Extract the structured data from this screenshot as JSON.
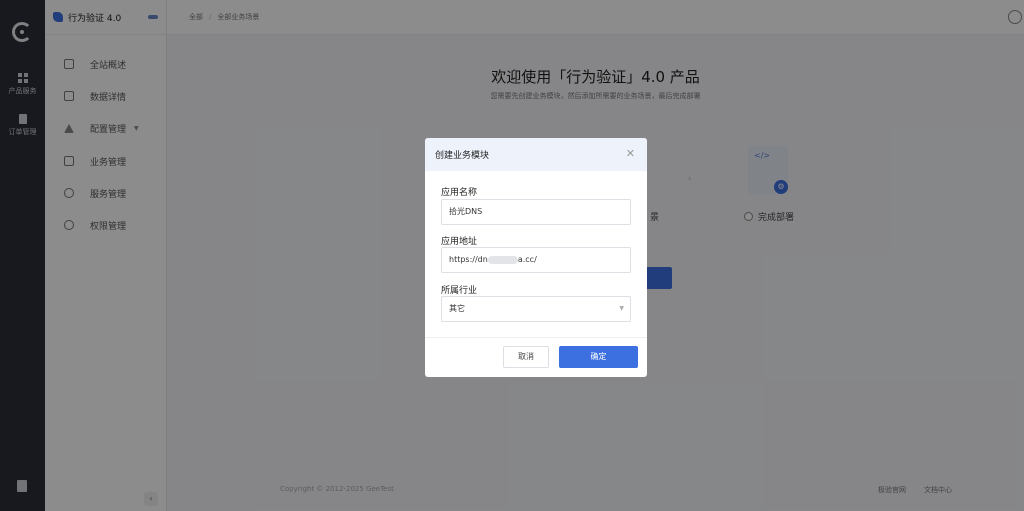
{
  "rail": {
    "items": [
      {
        "label": "产品服务",
        "icon": "grid-icon"
      },
      {
        "label": "订单管理",
        "icon": "document-icon"
      }
    ]
  },
  "sidebar": {
    "brand": "行为验证 4.0",
    "badge": "",
    "items": [
      {
        "label": "全站概述",
        "icon": "page-icon"
      },
      {
        "label": "数据详情",
        "icon": "chart-icon"
      },
      {
        "label": "配置管理",
        "icon": "warning-icon"
      },
      {
        "label": "业务管理",
        "icon": "box-icon"
      },
      {
        "label": "服务管理",
        "icon": "gear-icon"
      },
      {
        "label": "权限管理",
        "icon": "lock-icon"
      }
    ]
  },
  "topbar": {
    "breadcrumb": [
      "全部",
      "全部业务场景"
    ]
  },
  "main": {
    "title": "欢迎使用「行为验证」4.0 产品",
    "subtitle": "您需要先创建业务模块，然后添加所需要的业务场景，最后完成部署",
    "step_fragment": "景",
    "step_done": "完成部署"
  },
  "footer": {
    "copyright": "Copyright © 2012-2025 GeeTest",
    "link1": "极验官网",
    "link2": "文档中心"
  },
  "modal": {
    "title": "创建业务模块",
    "name_label": "应用名称",
    "name_value": "拾光DNS",
    "url_label": "应用地址",
    "url_prefix": "https://dn",
    "url_suffix": "a.cc/",
    "industry_label": "所属行业",
    "industry_value": "其它",
    "cancel_label": "取消",
    "ok_label": "确定"
  },
  "colors": {
    "primary": "#3c6fe0",
    "rail_bg": "#2b2f3a",
    "modal_head_bg": "#eef2fb"
  }
}
